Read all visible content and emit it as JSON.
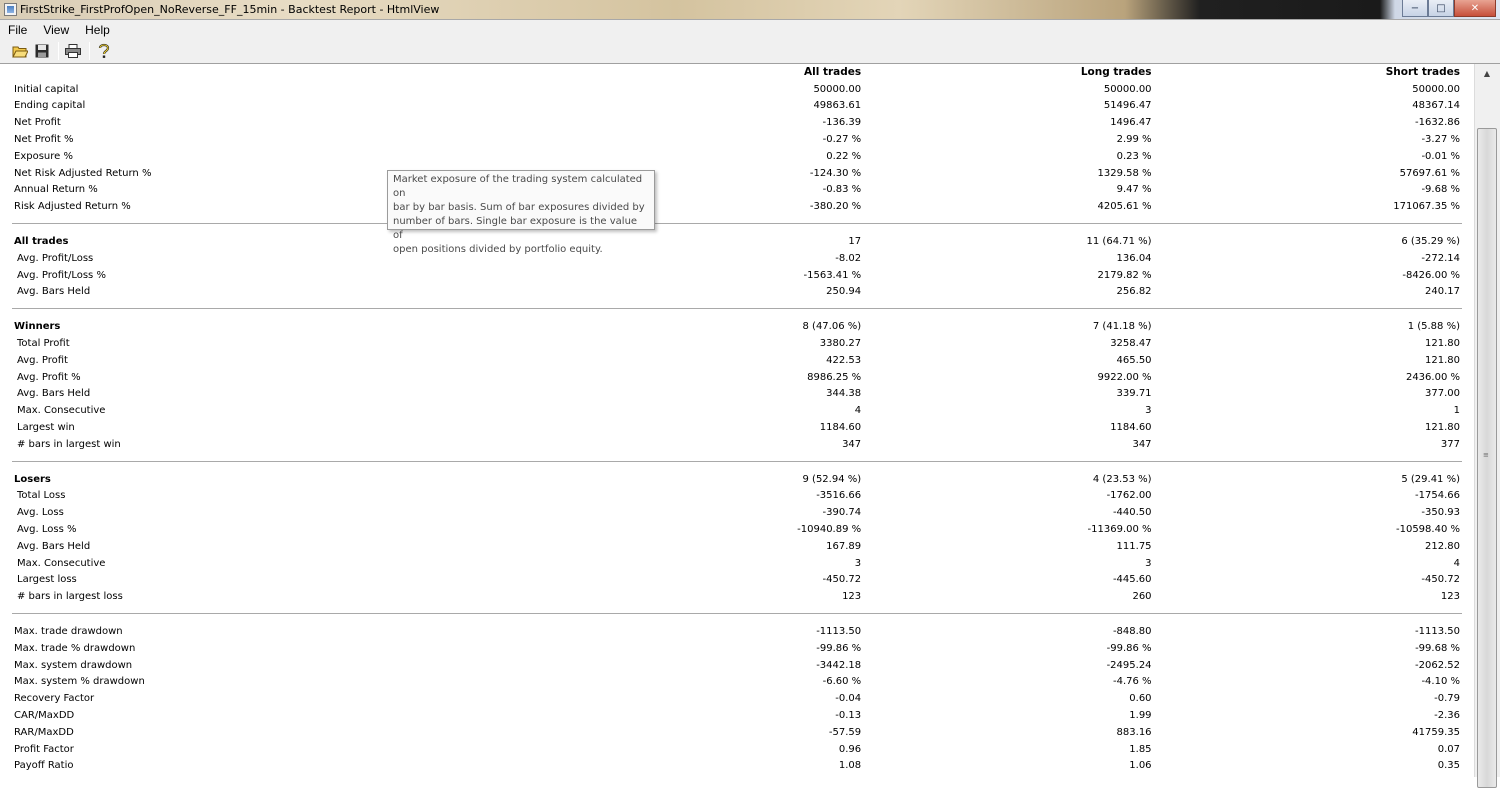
{
  "window": {
    "title": "FirstStrike_FirstProfOpen_NoReverse_FF_15min - Backtest Report - HtmlView",
    "minimize_glyph": "−",
    "maximize_glyph": "□",
    "close_glyph": "✕"
  },
  "menu": [
    "File",
    "View",
    "Help"
  ],
  "toolbar": {
    "icons": [
      "open-folder-icon",
      "save-disk-icon",
      "print-icon",
      "help-question-icon"
    ]
  },
  "colors": {
    "table_rule": "#a9a9a9",
    "tooltip_bg": "#fafafa",
    "close_button": "#c74f3a"
  },
  "columns": [
    "",
    "All trades",
    "Long trades",
    "Short trades"
  ],
  "summary": [
    {
      "label": "Initial capital",
      "all": "50000.00",
      "long": "50000.00",
      "short": "50000.00"
    },
    {
      "label": "Ending capital",
      "all": "49863.61",
      "long": "51496.47",
      "short": "48367.14"
    },
    {
      "label": "Net Profit",
      "all": "-136.39",
      "long": "1496.47",
      "short": "-1632.86"
    },
    {
      "label": "Net Profit %",
      "all": "-0.27 %",
      "long": "2.99 %",
      "short": "-3.27 %"
    },
    {
      "label": "Exposure %",
      "all": "0.22 %",
      "long": "0.23 %",
      "short": "-0.01 %"
    },
    {
      "label": "Net Risk Adjusted Return %",
      "all": "-124.30 %",
      "long": "1329.58 %",
      "short": "57697.61 %"
    },
    {
      "label": "Annual Return %",
      "all": "-0.83 %",
      "long": "9.47 %",
      "short": "-9.68 %"
    },
    {
      "label": "Risk Adjusted Return %",
      "all": "-380.20 %",
      "long": "4205.61 %",
      "short": "171067.35 %"
    }
  ],
  "all_trades": {
    "header": {
      "label": "All trades",
      "all": "17",
      "long": "11 (64.71 %)",
      "short": "6 (35.29 %)"
    },
    "rows": [
      {
        "label": "Avg. Profit/Loss",
        "all": "-8.02",
        "long": "136.04",
        "short": "-272.14"
      },
      {
        "label": "Avg. Profit/Loss %",
        "all": "-1563.41 %",
        "long": "2179.82 %",
        "short": "-8426.00 %"
      },
      {
        "label": "Avg. Bars Held",
        "all": "250.94",
        "long": "256.82",
        "short": "240.17"
      }
    ]
  },
  "winners": {
    "header": {
      "label": "Winners",
      "all": "8 (47.06 %)",
      "long": "7 (41.18 %)",
      "short": "1 (5.88 %)"
    },
    "rows": [
      {
        "label": "Total Profit",
        "all": "3380.27",
        "long": "3258.47",
        "short": "121.80"
      },
      {
        "label": "Avg. Profit",
        "all": "422.53",
        "long": "465.50",
        "short": "121.80"
      },
      {
        "label": "Avg. Profit %",
        "all": "8986.25 %",
        "long": "9922.00 %",
        "short": "2436.00 %"
      },
      {
        "label": "Avg. Bars Held",
        "all": "344.38",
        "long": "339.71",
        "short": "377.00"
      },
      {
        "label": "Max. Consecutive",
        "all": "4",
        "long": "3",
        "short": "1"
      },
      {
        "label": "Largest win",
        "all": "1184.60",
        "long": "1184.60",
        "short": "121.80"
      },
      {
        "label": "# bars in largest win",
        "all": "347",
        "long": "347",
        "short": "377"
      }
    ]
  },
  "losers": {
    "header": {
      "label": "Losers",
      "all": "9 (52.94 %)",
      "long": "4 (23.53 %)",
      "short": "5 (29.41 %)"
    },
    "rows": [
      {
        "label": "Total Loss",
        "all": "-3516.66",
        "long": "-1762.00",
        "short": "-1754.66"
      },
      {
        "label": "Avg. Loss",
        "all": "-390.74",
        "long": "-440.50",
        "short": "-350.93"
      },
      {
        "label": "Avg. Loss %",
        "all": "-10940.89 %",
        "long": "-11369.00 %",
        "short": "-10598.40 %"
      },
      {
        "label": "Avg. Bars Held",
        "all": "167.89",
        "long": "111.75",
        "short": "212.80"
      },
      {
        "label": "Max. Consecutive",
        "all": "3",
        "long": "3",
        "short": "4"
      },
      {
        "label": "Largest loss",
        "all": "-450.72",
        "long": "-445.60",
        "short": "-450.72"
      },
      {
        "label": "# bars in largest loss",
        "all": "123",
        "long": "260",
        "short": "123"
      }
    ]
  },
  "drawdown": [
    {
      "label": "Max. trade drawdown",
      "all": "-1113.50",
      "long": "-848.80",
      "short": "-1113.50"
    },
    {
      "label": "Max. trade % drawdown",
      "all": "-99.86 %",
      "long": "-99.86 %",
      "short": "-99.68 %"
    },
    {
      "label": "Max. system drawdown",
      "all": "-3442.18",
      "long": "-2495.24",
      "short": "-2062.52"
    },
    {
      "label": "Max. system % drawdown",
      "all": "-6.60 %",
      "long": "-4.76 %",
      "short": "-4.10 %"
    },
    {
      "label": "Recovery Factor",
      "all": "-0.04",
      "long": "0.60",
      "short": "-0.79"
    },
    {
      "label": "CAR/MaxDD",
      "all": "-0.13",
      "long": "1.99",
      "short": "-2.36"
    },
    {
      "label": "RAR/MaxDD",
      "all": "-57.59",
      "long": "883.16",
      "short": "41759.35"
    },
    {
      "label": "Profit Factor",
      "all": "0.96",
      "long": "1.85",
      "short": "0.07"
    },
    {
      "label": "Payoff Ratio",
      "all": "1.08",
      "long": "1.06",
      "short": "0.35"
    }
  ],
  "tooltip": {
    "lines": [
      "Market exposure of the trading system calculated on",
      "bar by bar basis. Sum of bar exposures divided by",
      "number of bars. Single bar exposure is the value of",
      "open positions divided by portfolio equity."
    ]
  }
}
